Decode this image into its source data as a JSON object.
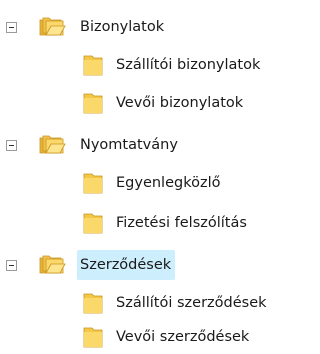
{
  "tree": {
    "groups": [
      {
        "label": "Bizonylatok",
        "expanded": true,
        "children": [
          "Szállítói bizonylatok",
          "Vevői bizonylatok"
        ]
      },
      {
        "label": "Nyomtatvány",
        "expanded": true,
        "children": [
          "Egyenlegközlő",
          "Fizetési felszólítás"
        ]
      },
      {
        "label": "Szerződések",
        "expanded": true,
        "selected": true,
        "children": [
          "Szállítói szerződések",
          "Vevői szerződések"
        ]
      }
    ]
  },
  "colors": {
    "selection": "#cdeefc",
    "folder": "#f3c748"
  },
  "icons": {
    "collapse": "minus-box-icon",
    "group": "stacked-folders-icon",
    "item": "folder-icon"
  }
}
